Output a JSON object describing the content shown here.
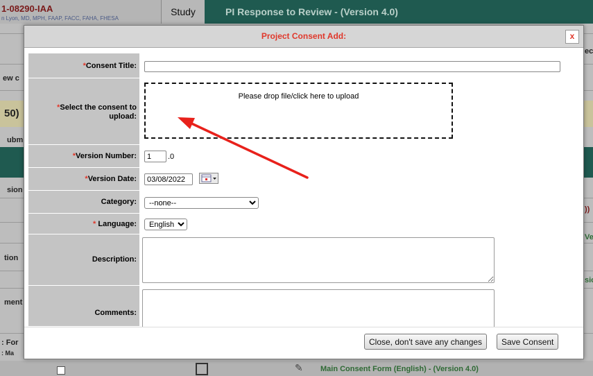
{
  "background": {
    "record_id": "1-08290-IAA",
    "pi_line": "n Lyon, MD, MPH, FAAP, FACC, FAHA, FHESA",
    "study_tab": "Study",
    "page_title": "PI Response to Review - (Version 4.0)",
    "fragments": {
      "ew": "ew c",
      "fifty": "50)",
      "ubm": "ubm",
      "sion": "sion",
      "tion": "tion",
      "ment": "ment",
      "for": ": For",
      "ma": ": Ma",
      "ect": "ect",
      "n_right": "))",
      "ver": "Ver",
      "sio": "sio"
    },
    "bottom_row_text": "Main Consent Form (English) - (Version 4.0)"
  },
  "modal": {
    "title": "Project Consent Add:",
    "close_label": "x",
    "fields": {
      "consent_title": {
        "label": "Consent Title:",
        "value": ""
      },
      "upload": {
        "label": "Select the consent to upload:",
        "drop_text": "Please drop file/click here to upload"
      },
      "version_number": {
        "label": "Version Number:",
        "value": "1",
        "suffix": ".0"
      },
      "version_date": {
        "label": "Version Date:",
        "value": "03/08/2022"
      },
      "category": {
        "label": "Category:",
        "value": "--none--"
      },
      "language": {
        "label": "Language:",
        "value": "English"
      },
      "description": {
        "label": "Description:",
        "value": ""
      },
      "comments": {
        "label": "Comments:",
        "value": ""
      }
    },
    "required_marker": "*",
    "buttons": {
      "cancel": "Close, don't save any changes",
      "save": "Save Consent"
    }
  },
  "annotation": {
    "color": "#e8211b"
  },
  "colors": {
    "required": "#e0382b",
    "header_green": "#1f5a50"
  }
}
